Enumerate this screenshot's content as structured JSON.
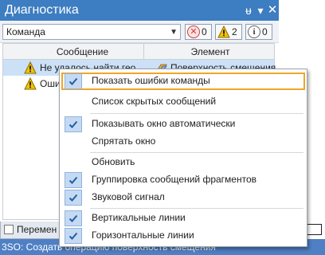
{
  "window": {
    "title": "Диагностика",
    "pin_glyph": "ᵾ",
    "dropdown_glyph": "▾",
    "close_glyph": "✕"
  },
  "toolbar": {
    "filter_value": "Команда",
    "filter_arrow": "▼",
    "error_count": "0",
    "warning_count": "2",
    "info_count": "0",
    "error_icon_glyph": "✕",
    "info_icon_glyph": "i"
  },
  "grid": {
    "columns": [
      "Сообщение",
      "Элемент"
    ],
    "rows": [
      {
        "message": "Не удалось найти гео...",
        "element": "Поверхность смещения",
        "icon": "warning-icon",
        "selected": true
      },
      {
        "message": "Ошиб",
        "element": "",
        "icon": "warning-icon",
        "selected": false
      }
    ]
  },
  "bottom_tab": {
    "label": "Перемен"
  },
  "status": {
    "text": "3SO: Создать операцию поверхность смещения"
  },
  "context_menu": {
    "items": [
      {
        "label": "Показать ошибки команды",
        "checked": true,
        "highlighted": true
      },
      {
        "label": "Список скрытых сообщений",
        "checked": false
      },
      {
        "label": "Показывать окно автоматически",
        "checked": true
      },
      {
        "label": "Спрятать окно",
        "checked": false
      },
      {
        "label": "Обновить",
        "checked": false
      },
      {
        "label": "Группировка сообщений фрагментов",
        "checked": true
      },
      {
        "label": "Звуковой сигнал",
        "checked": true
      },
      {
        "label": "Вертикальные линии",
        "checked": true
      },
      {
        "label": "Горизонтальные линии",
        "checked": true
      }
    ]
  },
  "colors": {
    "title_bar": "#3d7dc1",
    "status_bar": "#4f7fc4",
    "selection": "#cce1f7",
    "highlight_border": "#f0a526",
    "check_bg": "#c5daf2",
    "check_mark": "#1f5fa8",
    "warning": "#f2c200",
    "error": "#d03a3a"
  }
}
